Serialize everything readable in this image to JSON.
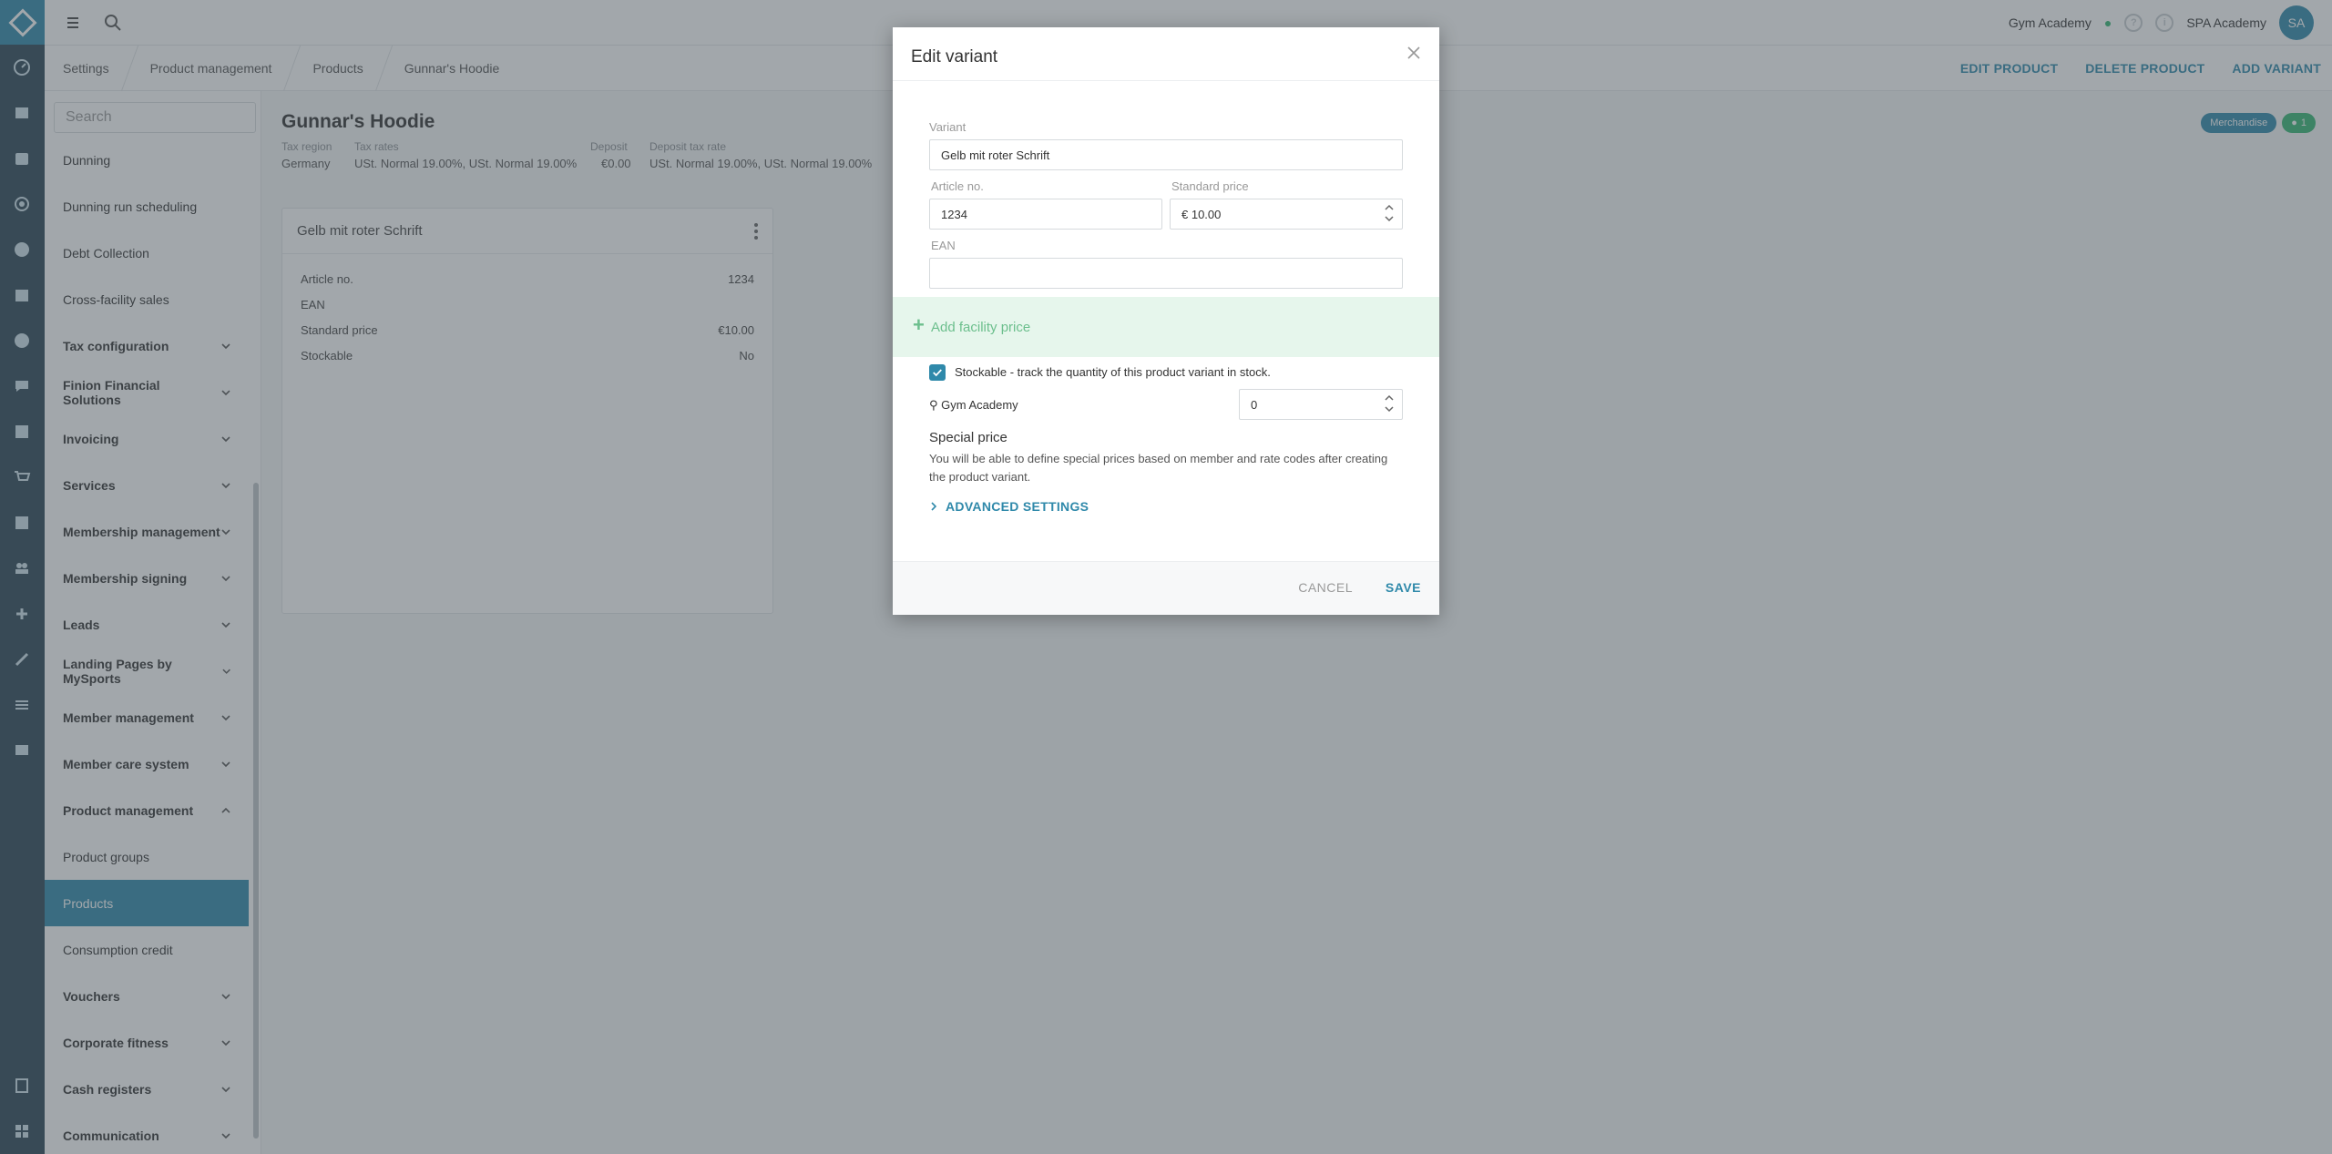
{
  "topbar": {
    "facility": "Gym Academy",
    "account_name": "SPA Academy",
    "avatar_initials": "SA"
  },
  "breadcrumb": [
    "Settings",
    "Product management",
    "Products",
    "Gunnar's Hoodie"
  ],
  "actions": {
    "edit_product": "EDIT PRODUCT",
    "delete_product": "DELETE PRODUCT",
    "add_variant": "ADD VARIANT"
  },
  "sidebar": {
    "search_placeholder": "Search",
    "items": [
      {
        "label": "Dunning",
        "type": "item"
      },
      {
        "label": "Dunning run scheduling",
        "type": "item"
      },
      {
        "label": "Debt Collection",
        "type": "item"
      },
      {
        "label": "Cross-facility sales",
        "type": "item"
      },
      {
        "label": "Tax configuration",
        "type": "group"
      },
      {
        "label": "Finion Financial Solutions",
        "type": "group"
      },
      {
        "label": "Invoicing",
        "type": "group"
      },
      {
        "label": "Services",
        "type": "group"
      },
      {
        "label": "Membership management",
        "type": "group"
      },
      {
        "label": "Membership signing",
        "type": "group"
      },
      {
        "label": "Leads",
        "type": "group"
      },
      {
        "label": "Landing Pages by MySports",
        "type": "group"
      },
      {
        "label": "Member management",
        "type": "group"
      },
      {
        "label": "Member care system",
        "type": "group"
      },
      {
        "label": "Product management",
        "type": "group-open"
      },
      {
        "label": "Product groups",
        "type": "item"
      },
      {
        "label": "Products",
        "type": "active"
      },
      {
        "label": "Consumption credit",
        "type": "item"
      },
      {
        "label": "Vouchers",
        "type": "group"
      },
      {
        "label": "Corporate fitness",
        "type": "group"
      },
      {
        "label": "Cash registers",
        "type": "group"
      },
      {
        "label": "Communication",
        "type": "group"
      }
    ]
  },
  "product": {
    "title": "Gunnar's Hoodie",
    "meta": [
      {
        "label": "Tax region",
        "value": "Germany"
      },
      {
        "label": "Tax rates",
        "value": "USt. Normal 19.00%, USt. Normal 19.00%"
      },
      {
        "label": "Deposit",
        "value": "€0.00"
      },
      {
        "label": "Deposit tax rate",
        "value": "USt. Normal 19.00%, USt. Normal 19.00%"
      }
    ],
    "badges": {
      "category": "Merchandise",
      "facility_count": "1"
    },
    "variant_card": {
      "title": "Gelb mit roter Schrift",
      "rows": [
        {
          "label": "Article no.",
          "value": "1234"
        },
        {
          "label": "EAN",
          "value": ""
        },
        {
          "label": "Standard price",
          "value": "€10.00"
        },
        {
          "label": "Stockable",
          "value": "No"
        }
      ]
    }
  },
  "modal": {
    "title": "Edit variant",
    "variant_label": "Variant",
    "variant_value": "Gelb mit roter Schrift",
    "article_label": "Article no.",
    "article_value": "1234",
    "price_label": "Standard price",
    "price_value": "€ 10.00",
    "ean_label": "EAN",
    "ean_value": "",
    "add_facility_price": "Add facility price",
    "stockable_label": "Stockable - track the quantity of this product variant in stock.",
    "stockable_checked": true,
    "facility_name": "Gym Academy",
    "facility_qty": "0",
    "special_price_title": "Special price",
    "special_price_text": "You will be able to define special prices based on member and rate codes after creating the product variant.",
    "advanced_settings": "ADVANCED SETTINGS",
    "cancel": "CANCEL",
    "save": "SAVE"
  },
  "colors": {
    "accent": "#2f89aa",
    "rail": "#2a4455",
    "success": "#35b772"
  }
}
